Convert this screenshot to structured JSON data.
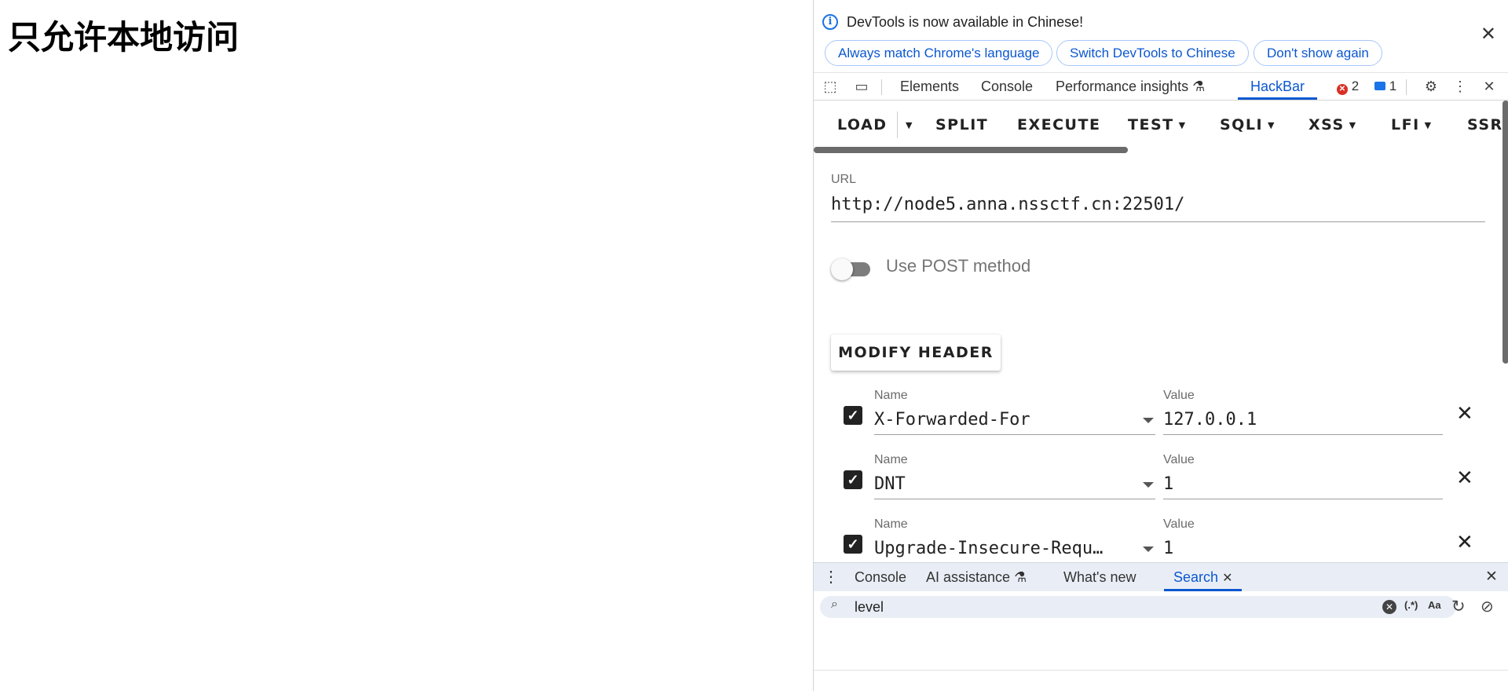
{
  "page": {
    "heading": "只允许本地访问"
  },
  "infobar": {
    "icon": "info-icon",
    "message": "DevTools is now available in Chinese!",
    "buttons": [
      "Always match Chrome's language",
      "Switch DevTools to Chinese",
      "Don't show again"
    ]
  },
  "toolbar": {
    "tabs": [
      "Elements",
      "Console",
      "Performance insights",
      "HackBar"
    ],
    "active_tab": "HackBar",
    "error_count": "2",
    "message_count": "1"
  },
  "hackbar": {
    "actions": [
      "LOAD",
      "SPLIT",
      "EXECUTE",
      "TEST",
      "SQLI",
      "XSS",
      "LFI",
      "SSRF"
    ],
    "url_label": "URL",
    "url": "http://node5.anna.nssctf.cn:22501/",
    "post_label": "Use POST method",
    "post_enabled": false,
    "modify_header_label": "MODIFY HEADER",
    "headers": [
      {
        "checked": true,
        "name_label": "Name",
        "name": "X-Forwarded-For",
        "value_label": "Value",
        "value": "127.0.0.1"
      },
      {
        "checked": true,
        "name_label": "Name",
        "name": "DNT",
        "value_label": "Value",
        "value": "1"
      },
      {
        "checked": true,
        "name_label": "Name",
        "name": "Upgrade-Insecure-Requ…",
        "value_label": "Value",
        "value": "1"
      }
    ]
  },
  "drawer": {
    "tabs": [
      "Console",
      "AI assistance",
      "What's new",
      "Search"
    ],
    "active_tab": "Search",
    "search_value": "level",
    "regex_label": "(.*)",
    "case_label": "Aa"
  },
  "colors": {
    "accent": "#0b57d0",
    "error": "#d93025",
    "drawer_bg": "#e9eef6"
  }
}
